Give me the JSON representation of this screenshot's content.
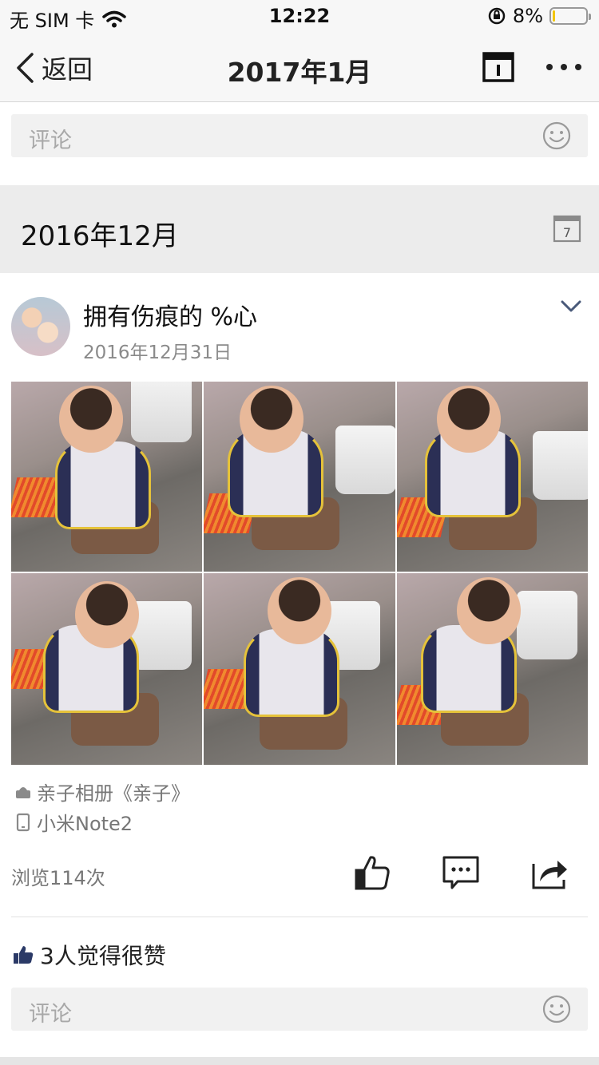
{
  "status_bar": {
    "carrier": "无 SIM 卡",
    "time": "12:22",
    "battery_text": "8%",
    "battery_level": 0.08,
    "battery_color": "#f2c500"
  },
  "nav": {
    "back_label": "返回",
    "title": "2017年1月",
    "calendar_icon": "calendar-icon",
    "more_icon": "more-dots-icon"
  },
  "top_comment": {
    "placeholder": "评论",
    "emoji_icon": "smile-icon"
  },
  "month_section": {
    "title": "2016年12月",
    "calendar_icon": "calendar-7-icon",
    "calendar_day": "7"
  },
  "post": {
    "user_name": "拥有伤痕的 %心",
    "date": "2016年12月31日",
    "photo_count": 6,
    "album": "亲子相册《亲子》",
    "device": "小米Note2",
    "views": "浏览114次",
    "like_summary": "3人觉得很赞",
    "accent_color": "#2b3a67"
  },
  "bottom_comment": {
    "placeholder": "评论",
    "emoji_icon": "smile-icon"
  }
}
